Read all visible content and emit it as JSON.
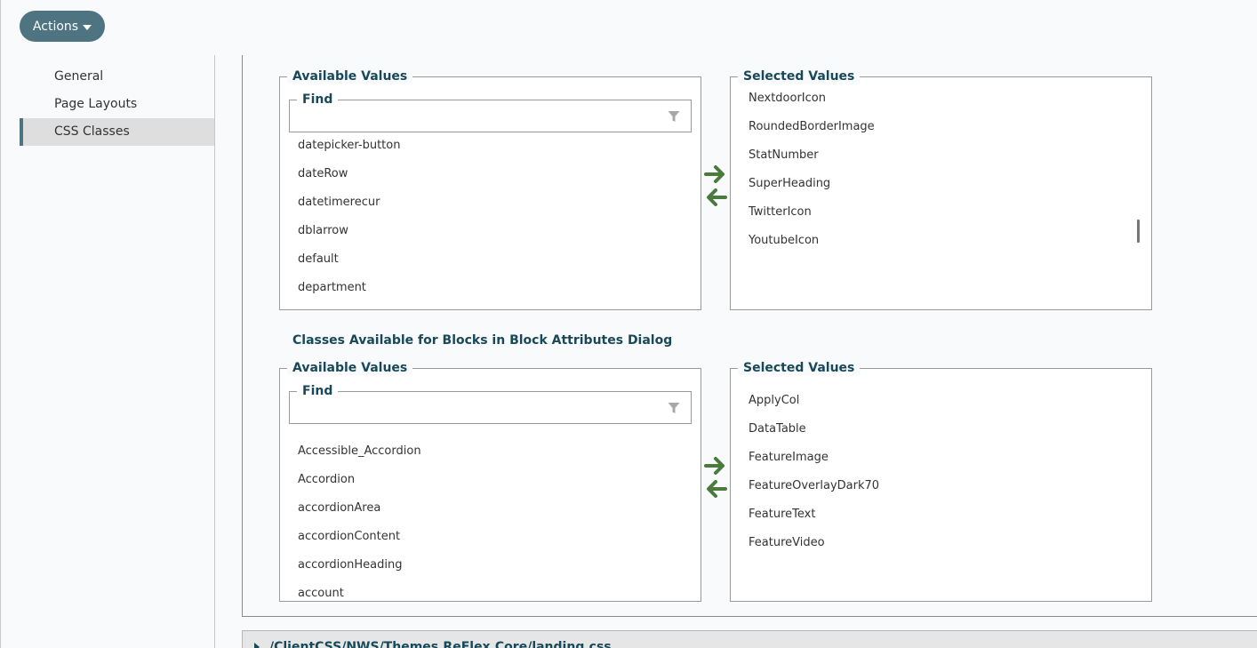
{
  "actions": {
    "label": "Actions"
  },
  "side_nav": {
    "items": [
      {
        "label": "General"
      },
      {
        "label": "Page Layouts"
      },
      {
        "label": "CSS Classes"
      }
    ]
  },
  "top_section": {
    "available": {
      "legend": "Available Values",
      "find_label": "Find",
      "find_value": "",
      "items": [
        "datepicker-button",
        "dateRow",
        "datetimerecur",
        "dblarrow",
        "default",
        "department"
      ]
    },
    "selected": {
      "legend": "Selected Values",
      "items": [
        "NextdoorIcon",
        "RoundedBorderImage",
        "StatNumber",
        "SuperHeading",
        "TwitterIcon",
        "YoutubeIcon"
      ]
    }
  },
  "block_section": {
    "title": "Classes Available for Blocks in Block Attributes Dialog",
    "available": {
      "legend": "Available Values",
      "find_label": "Find",
      "find_value": "",
      "items": [
        "Accessible_Accordion",
        "Accordion",
        "accordionArea",
        "accordionContent",
        "accordionHeading",
        "account"
      ]
    },
    "selected": {
      "legend": "Selected Values",
      "items": [
        "ApplyCol",
        "DataTable",
        "FeatureImage",
        "FeatureOverlayDark70",
        "FeatureText",
        "FeatureVideo"
      ]
    }
  },
  "collapsed_file": {
    "path": "/ClientCSS/NWS/Themes.ReFlex.Core/landing.css"
  },
  "colors": {
    "accent": "#4e7482",
    "heading": "#17495a",
    "arrow": "#4a7a3c"
  }
}
